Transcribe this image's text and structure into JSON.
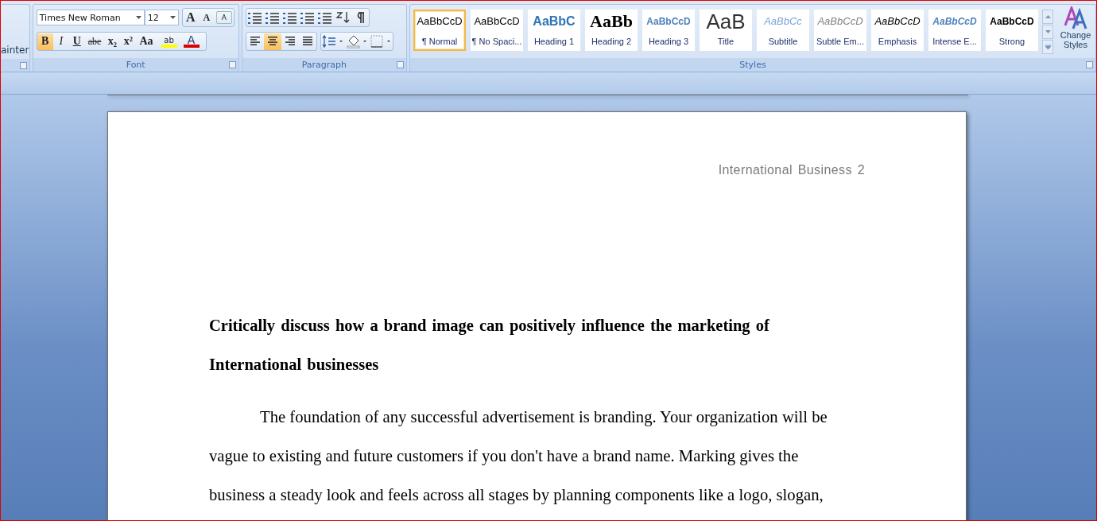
{
  "clipboard": {
    "format_painter_label": "ainter"
  },
  "font": {
    "font_name": "Times New Roman",
    "font_size": "12",
    "group_label": "Font",
    "row1": [
      {
        "kind": "grow",
        "text": "A"
      },
      {
        "kind": "shrink",
        "text": "A"
      },
      {
        "kind": "clear",
        "text": "A"
      }
    ],
    "row2": [
      {
        "kind": "bold",
        "text": "B",
        "selected": true
      },
      {
        "kind": "italic",
        "text": "I",
        "selected": false
      },
      {
        "kind": "underline",
        "text": "U",
        "selected": false
      },
      {
        "kind": "strike",
        "text": "abe",
        "selected": false
      },
      {
        "kind": "sub",
        "text": "x₂",
        "selected": false
      },
      {
        "kind": "sup",
        "text": "x²",
        "selected": false
      },
      {
        "kind": "case",
        "text": "Aa",
        "selected": false
      },
      {
        "kind": "highlight",
        "text": "ab",
        "selected": false
      },
      {
        "kind": "color",
        "text": "A",
        "selected": false
      }
    ]
  },
  "paragraph": {
    "group_label": "Paragraph",
    "row1": [
      {
        "kind": "bullets"
      },
      {
        "kind": "numbering"
      },
      {
        "kind": "multilevel"
      },
      {
        "kind": "outdent"
      },
      {
        "kind": "indent"
      },
      {
        "kind": "sort"
      },
      {
        "kind": "pilcrow"
      }
    ],
    "alignment": [
      {
        "kind": "left",
        "selected": false
      },
      {
        "kind": "center",
        "selected": true
      },
      {
        "kind": "right",
        "selected": false
      },
      {
        "kind": "justify",
        "selected": false
      }
    ],
    "row2": [
      {
        "kind": "spacing"
      },
      {
        "kind": "shading"
      },
      {
        "kind": "borders"
      }
    ]
  },
  "styles": {
    "group_label": "Styles",
    "change_styles": "Change Styles",
    "items": [
      {
        "kind": "normal",
        "preview": "AaBbCcD",
        "label": "¶ Normal",
        "selected": true
      },
      {
        "kind": "no_spacing",
        "preview": "AaBbCcD",
        "label": "¶ No Spaci...",
        "selected": false
      },
      {
        "kind": "heading1",
        "preview": "AaBbC",
        "label": "Heading 1",
        "selected": false
      },
      {
        "kind": "heading2",
        "preview": "AaBb",
        "label": "Heading 2",
        "selected": false
      },
      {
        "kind": "heading3",
        "preview": "AaBbCcD",
        "label": "Heading 3",
        "selected": false
      },
      {
        "kind": "title",
        "preview": "AaB",
        "label": "Title",
        "selected": false
      },
      {
        "kind": "subtitle",
        "preview": "AaBbCc",
        "label": "Subtitle",
        "selected": false
      },
      {
        "kind": "subtle_emphasis",
        "preview": "AaBbCcD",
        "label": "Subtle Em...",
        "selected": false
      },
      {
        "kind": "emphasis",
        "preview": "AaBbCcD",
        "label": "Emphasis",
        "selected": false
      },
      {
        "kind": "intense_emphasis",
        "preview": "AaBbCcD",
        "label": "Intense E...",
        "selected": false
      },
      {
        "kind": "strong",
        "preview": "AaBbCcD",
        "label": "Strong",
        "selected": false
      }
    ]
  },
  "document": {
    "header": "International Business 2",
    "title": "Critically discuss how a brand image can positively influence the marketing of International businesses",
    "paragraphs": [
      "The foundation of any successful advertisement is branding. Your organization will be vague to existing and future customers if you don't have a brand name. Marking gives the business a steady look and feels across all stages by planning components like a logo, slogan,"
    ]
  }
}
